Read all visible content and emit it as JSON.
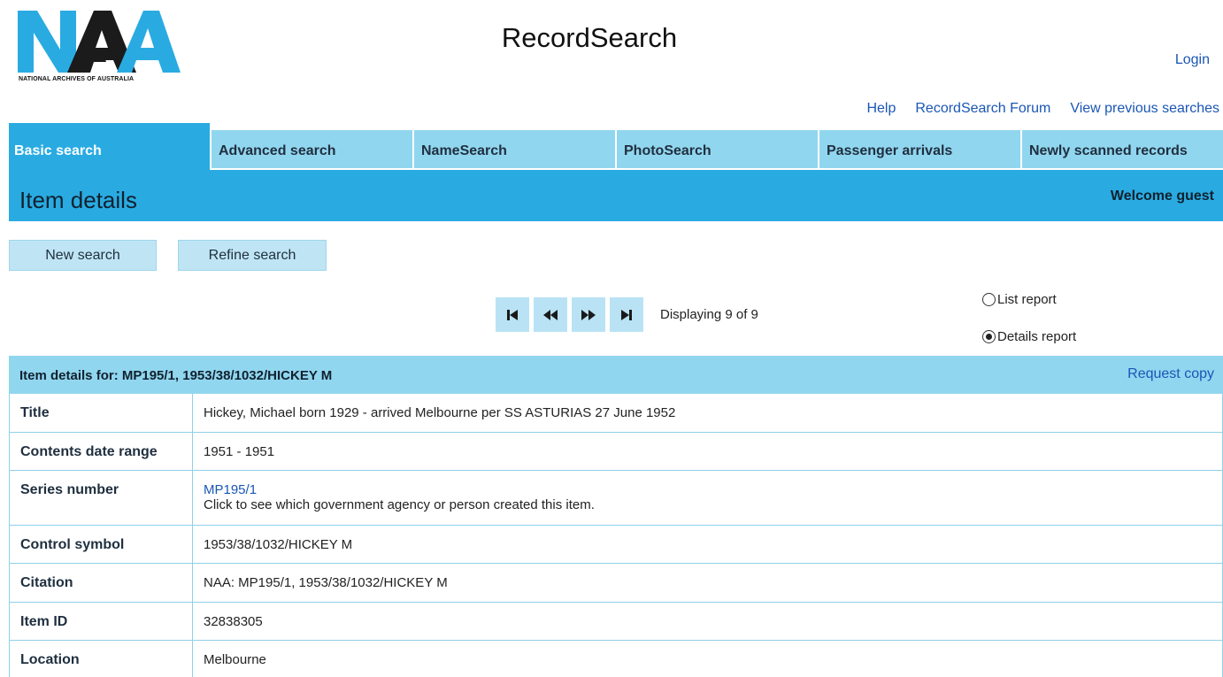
{
  "header": {
    "logo_text": "NAA",
    "logo_caption": "NATIONAL ARCHIVES OF AUSTRALIA",
    "app_title": "RecordSearch",
    "login": "Login",
    "links": [
      "Help",
      "RecordSearch Forum",
      "View previous searches"
    ]
  },
  "tabs": [
    {
      "label": "Basic search",
      "active": true
    },
    {
      "label": "Advanced search",
      "active": false
    },
    {
      "label": "NameSearch",
      "active": false
    },
    {
      "label": "PhotoSearch",
      "active": false
    },
    {
      "label": "Passenger arrivals",
      "active": false
    },
    {
      "label": "Newly scanned records",
      "active": false
    }
  ],
  "title_bar": {
    "title": "Item details",
    "welcome": "Welcome guest"
  },
  "buttons": {
    "new_search": "New search",
    "refine_search": "Refine search"
  },
  "pager": {
    "status": "Displaying 9 of 9",
    "icons": [
      "first-page-icon",
      "previous-page-icon",
      "next-page-icon",
      "last-page-icon"
    ]
  },
  "report_options": [
    {
      "label": "List report",
      "checked": false
    },
    {
      "label": "Details report",
      "checked": true
    }
  ],
  "details": {
    "header": "Item details for: MP195/1, 1953/38/1032/HICKEY M",
    "request_copy": "Request copy",
    "rows": [
      {
        "label": "Title",
        "value": "Hickey, Michael born 1929 - arrived Melbourne per SS ASTURIAS 27 June 1952"
      },
      {
        "label": "Contents date range",
        "value": "1951 - 1951"
      },
      {
        "label": "Series number",
        "link": "MP195/1",
        "note": "Click to see which government agency or person created this item."
      },
      {
        "label": "Control symbol",
        "value": "1953/38/1032/HICKEY M"
      },
      {
        "label": "Citation",
        "value": "NAA: MP195/1, 1953/38/1032/HICKEY M"
      },
      {
        "label": "Item ID",
        "value": "32838305"
      },
      {
        "label": "Location",
        "value": "Melbourne"
      }
    ]
  },
  "colors": {
    "brand_blue": "#29abe2",
    "tab_light": "#91d6ef",
    "link": "#1a56b5",
    "logo_dark": "#1b1b1b"
  }
}
